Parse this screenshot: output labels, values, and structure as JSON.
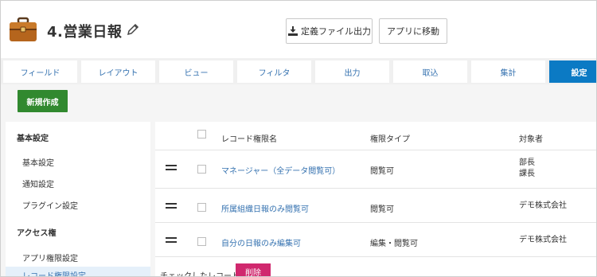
{
  "header": {
    "app_title": "4.営業日報",
    "export_label": "定義ファイル出力",
    "move_label": "アプリに移動"
  },
  "tabs": [
    {
      "label": "フィールド",
      "active": false
    },
    {
      "label": "レイアウト",
      "active": false
    },
    {
      "label": "ビュー",
      "active": false
    },
    {
      "label": "フィルタ",
      "active": false
    },
    {
      "label": "出力",
      "active": false
    },
    {
      "label": "取込",
      "active": false
    },
    {
      "label": "集計",
      "active": false
    },
    {
      "label": "設定",
      "active": true
    }
  ],
  "new_button_label": "新規作成",
  "sidebar": {
    "group1": "基本設定",
    "items1": [
      "基本設定",
      "通知設定",
      "プラグイン設定"
    ],
    "group2": "アクセス権",
    "items2": [
      "アプリ権限設定",
      "レコード権限設定"
    ]
  },
  "table": {
    "headers": [
      "レコード権限名",
      "権限タイプ",
      "対象者"
    ],
    "rows": [
      {
        "name": "マネージャー（全データ閲覧可）",
        "type": "閲覧可",
        "target_line1": "部長",
        "target_line2": "課長"
      },
      {
        "name": "所属組織日報のみ閲覧可",
        "type": "閲覧可",
        "target_line1": "デモ株式会社",
        "target_line2": ""
      },
      {
        "name": "自分の日報のみ編集可",
        "type": "編集・閲覧可",
        "target_line1": "デモ株式会社",
        "target_line2": ""
      }
    ],
    "footer_text": "チェックしたレコード権限を",
    "delete_label": "削除"
  },
  "colors": {
    "accent": "#0b7ac4",
    "new_button": "#31892f",
    "delete_button": "#d0286e",
    "link": "#3572b0"
  },
  "icons": [
    "briefcase-icon",
    "pencil-icon",
    "download-icon",
    "drag-handle-icon"
  ]
}
